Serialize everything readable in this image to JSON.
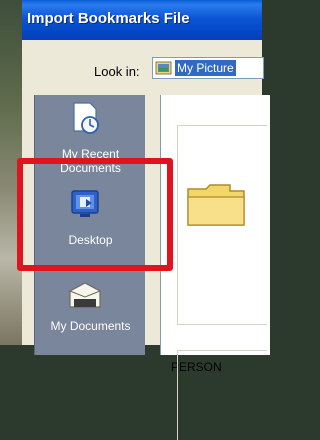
{
  "dialog": {
    "title": "Import Bookmarks File",
    "look_in_label": "Look in:",
    "look_in_value": "My Picture"
  },
  "places": [
    {
      "label_line1": "My Recent",
      "label_line2": "Documents",
      "icon": "recent-documents-icon"
    },
    {
      "label_line1": "Desktop",
      "label_line2": "",
      "icon": "desktop-icon"
    },
    {
      "label_line1": "My Documents",
      "label_line2": "",
      "icon": "my-documents-icon"
    }
  ],
  "files": [
    {
      "label": "PERSON",
      "icon": "folder-icon"
    }
  ],
  "annotation": {
    "color": "#e0141e",
    "target": "Desktop"
  },
  "colors": {
    "titlebar": "#0b56d4",
    "places_bar": "#7a869c",
    "selection": "#316ac5"
  }
}
